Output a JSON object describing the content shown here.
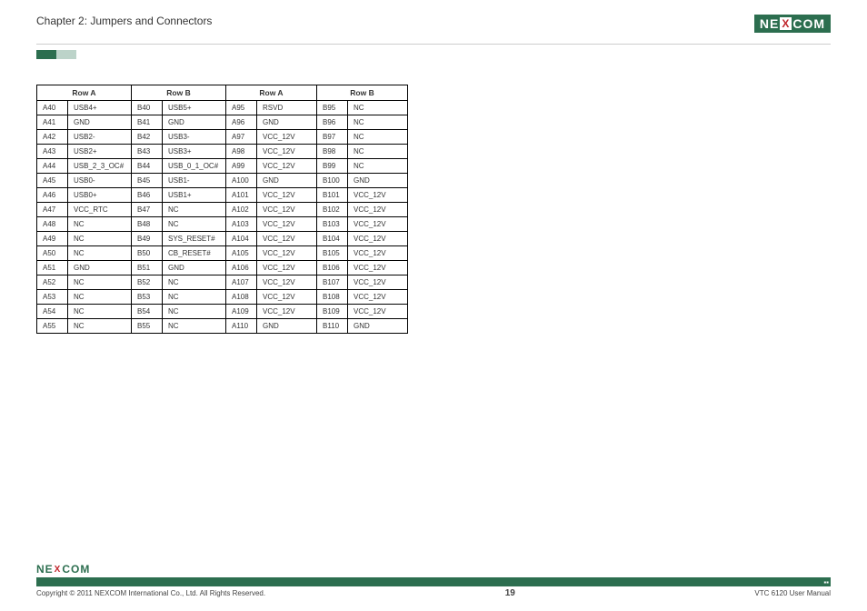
{
  "chapter_title": "Chapter 2: Jumpers and Connectors",
  "brand_letters": {
    "pre": "NE",
    "mid": "X",
    "post": "COM"
  },
  "table": {
    "headers": [
      "Row A",
      "Row B",
      "Row A",
      "Row B"
    ],
    "rows": [
      {
        "a_pin": "A40",
        "a_sig": "USB4+",
        "b_pin": "B40",
        "b_sig": "USB5+",
        "c_pin": "A95",
        "c_sig": "RSVD",
        "d_pin": "B95",
        "d_sig": "NC"
      },
      {
        "a_pin": "A41",
        "a_sig": "GND",
        "b_pin": "B41",
        "b_sig": "GND",
        "c_pin": "A96",
        "c_sig": "GND",
        "d_pin": "B96",
        "d_sig": "NC"
      },
      {
        "a_pin": "A42",
        "a_sig": "USB2-",
        "b_pin": "B42",
        "b_sig": "USB3-",
        "c_pin": "A97",
        "c_sig": "VCC_12V",
        "d_pin": "B97",
        "d_sig": "NC"
      },
      {
        "a_pin": "A43",
        "a_sig": "USB2+",
        "b_pin": "B43",
        "b_sig": "USB3+",
        "c_pin": "A98",
        "c_sig": "VCC_12V",
        "d_pin": "B98",
        "d_sig": "NC"
      },
      {
        "a_pin": "A44",
        "a_sig": "USB_2_3_OC#",
        "b_pin": "B44",
        "b_sig": "USB_0_1_OC#",
        "c_pin": "A99",
        "c_sig": "VCC_12V",
        "d_pin": "B99",
        "d_sig": "NC"
      },
      {
        "a_pin": "A45",
        "a_sig": "USB0-",
        "b_pin": "B45",
        "b_sig": "USB1-",
        "c_pin": "A100",
        "c_sig": "GND",
        "d_pin": "B100",
        "d_sig": "GND"
      },
      {
        "a_pin": "A46",
        "a_sig": "USB0+",
        "b_pin": "B46",
        "b_sig": "USB1+",
        "c_pin": "A101",
        "c_sig": "VCC_12V",
        "d_pin": "B101",
        "d_sig": "VCC_12V"
      },
      {
        "a_pin": "A47",
        "a_sig": "VCC_RTC",
        "b_pin": "B47",
        "b_sig": "NC",
        "c_pin": "A102",
        "c_sig": "VCC_12V",
        "d_pin": "B102",
        "d_sig": "VCC_12V"
      },
      {
        "a_pin": "A48",
        "a_sig": "NC",
        "b_pin": "B48",
        "b_sig": "NC",
        "c_pin": "A103",
        "c_sig": "VCC_12V",
        "d_pin": "B103",
        "d_sig": "VCC_12V"
      },
      {
        "a_pin": "A49",
        "a_sig": "NC",
        "b_pin": "B49",
        "b_sig": "SYS_RESET#",
        "c_pin": "A104",
        "c_sig": "VCC_12V",
        "d_pin": "B104",
        "d_sig": "VCC_12V"
      },
      {
        "a_pin": "A50",
        "a_sig": "NC",
        "b_pin": "B50",
        "b_sig": "CB_RESET#",
        "c_pin": "A105",
        "c_sig": "VCC_12V",
        "d_pin": "B105",
        "d_sig": "VCC_12V"
      },
      {
        "a_pin": "A51",
        "a_sig": "GND",
        "b_pin": "B51",
        "b_sig": "GND",
        "c_pin": "A106",
        "c_sig": "VCC_12V",
        "d_pin": "B106",
        "d_sig": "VCC_12V"
      },
      {
        "a_pin": "A52",
        "a_sig": "NC",
        "b_pin": "B52",
        "b_sig": "NC",
        "c_pin": "A107",
        "c_sig": "VCC_12V",
        "d_pin": "B107",
        "d_sig": "VCC_12V"
      },
      {
        "a_pin": "A53",
        "a_sig": "NC",
        "b_pin": "B53",
        "b_sig": "NC",
        "c_pin": "A108",
        "c_sig": "VCC_12V",
        "d_pin": "B108",
        "d_sig": "VCC_12V"
      },
      {
        "a_pin": "A54",
        "a_sig": "NC",
        "b_pin": "B54",
        "b_sig": "NC",
        "c_pin": "A109",
        "c_sig": "VCC_12V",
        "d_pin": "B109",
        "d_sig": "VCC_12V"
      },
      {
        "a_pin": "A55",
        "a_sig": "NC",
        "b_pin": "B55",
        "b_sig": "NC",
        "c_pin": "A110",
        "c_sig": "GND",
        "d_pin": "B110",
        "d_sig": "GND"
      }
    ]
  },
  "footer": {
    "copyright": "Copyright © 2011 NEXCOM International Co., Ltd. All Rights Reserved.",
    "page_number": "19",
    "manual_name": "VTC 6120 User Manual"
  }
}
